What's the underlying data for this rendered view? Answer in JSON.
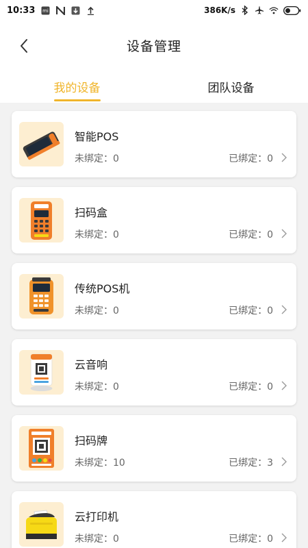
{
  "status_bar": {
    "time": "10:33",
    "net_speed": "386K/s",
    "icons": [
      "mi-notification-icon",
      "n-app-icon",
      "download-icon",
      "upload-icon",
      "bluetooth-icon",
      "airplane-icon",
      "wifi-icon",
      "battery-icon"
    ]
  },
  "header": {
    "title": "设备管理",
    "back_icon": "chevron-left-icon"
  },
  "tabs": [
    {
      "label": "我的设备",
      "active": true
    },
    {
      "label": "团队设备",
      "active": false
    }
  ],
  "colors": {
    "accent": "#f0b52b",
    "thumb_bg": "#fdeed1",
    "device_orange": "#f07f2a",
    "device_yellow": "#f6d916"
  },
  "devices": [
    {
      "name": "智能POS",
      "unbound_label": "未绑定：",
      "unbound": "0",
      "bound_label": "已绑定：",
      "bound": "0",
      "icon": "smart-pos-icon"
    },
    {
      "name": " 扫码盒",
      "unbound_label": "未绑定：",
      "unbound": "0",
      "bound_label": "已绑定：",
      "bound": "0",
      "icon": "scan-box-icon"
    },
    {
      "name": "传统POS机",
      "unbound_label": "未绑定：",
      "unbound": "0",
      "bound_label": "已绑定：",
      "bound": "0",
      "icon": "traditional-pos-icon"
    },
    {
      "name": "云音响",
      "unbound_label": "未绑定：",
      "unbound": "0",
      "bound_label": "已绑定：",
      "bound": "0",
      "icon": "cloud-speaker-icon"
    },
    {
      "name": "扫码牌",
      "unbound_label": "未绑定：",
      "unbound": "10",
      "bound_label": "已绑定：",
      "bound": "3",
      "icon": "qr-stand-icon"
    },
    {
      "name": "云打印机",
      "unbound_label": "未绑定：",
      "unbound": "0",
      "bound_label": "已绑定：",
      "bound": "0",
      "icon": "cloud-printer-icon"
    }
  ]
}
